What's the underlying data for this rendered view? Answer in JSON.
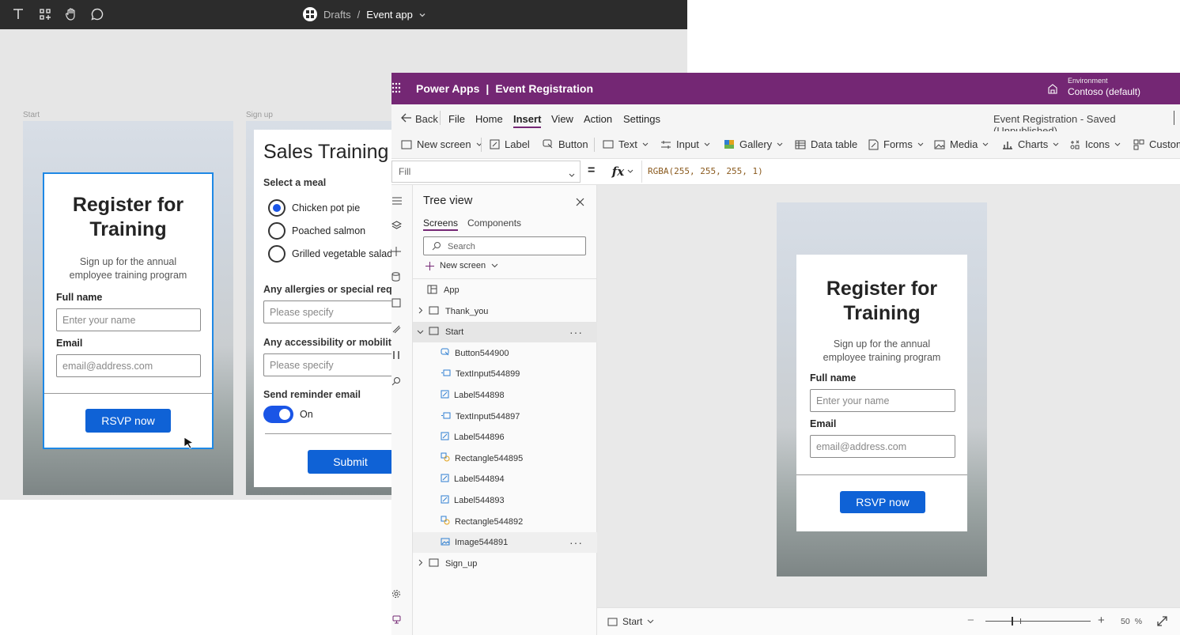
{
  "figma": {
    "breadcrumb": {
      "folder": "Drafts",
      "separator": "/",
      "file": "Event app"
    },
    "frames": {
      "start": {
        "label": "Start",
        "title": "Register for Training",
        "subtitle_l1": "Sign up for the annual",
        "subtitle_l2": "employee training program",
        "fullname_label": "Full name",
        "fullname_placeholder": "Enter your name",
        "email_label": "Email",
        "email_placeholder": "email@address.com",
        "button": "RSVP now"
      },
      "signup": {
        "label": "Sign up",
        "title": "Sales Training",
        "meal_label": "Select a meal",
        "meals": [
          "Chicken pot pie",
          "Poached salmon",
          "Grilled vegetable salad"
        ],
        "allergies_label": "Any allergies or special reque",
        "allergies_placeholder": "Please specify",
        "access_label": "Any accessibility or mobility",
        "access_placeholder": "Please specify",
        "reminder_label": "Send reminder email",
        "toggle_state": "On",
        "submit": "Submit"
      }
    }
  },
  "powerapps": {
    "app_name": "Power Apps",
    "separator": "|",
    "project": "Event Registration",
    "environment_label": "Environment",
    "environment_value": "Contoso (default)",
    "menu": {
      "back": "Back",
      "items": [
        "File",
        "Home",
        "Insert",
        "View",
        "Action",
        "Settings"
      ],
      "active": "Insert"
    },
    "save_status": "Event Registration - Saved (Unpublished)",
    "ribbon": [
      "New screen",
      "Label",
      "Button",
      "Text",
      "Input",
      "Gallery",
      "Data table",
      "Forms",
      "Media",
      "Charts",
      "Icons",
      "Custom"
    ],
    "formula": {
      "property": "Fill",
      "equals": "=",
      "fx": "fx",
      "value": "RGBA(255, 255, 255, 1)"
    },
    "tree": {
      "title": "Tree view",
      "tabs": [
        "Screens",
        "Components"
      ],
      "search_placeholder": "Search",
      "new_screen": "New screen",
      "app": "App",
      "screens": [
        "Thank_you",
        "Start",
        "Sign_up"
      ],
      "controls": [
        "Button544900",
        "TextInput544899",
        "Label544898",
        "TextInput544897",
        "Label544896",
        "Rectangle544895",
        "Label544894",
        "Label544893",
        "Rectangle544892",
        "Image544891"
      ],
      "more": "···"
    },
    "preview": {
      "title": "Register for Training",
      "subtitle_l1": "Sign up for the annual",
      "subtitle_l2": "employee training program",
      "fullname_label": "Full name",
      "fullname_placeholder": "Enter your name",
      "email_label": "Email",
      "email_placeholder": "email@address.com",
      "button": "RSVP now"
    },
    "status": {
      "screen": "Start",
      "zoom": "50",
      "zoom_unit": "%",
      "minus": "−",
      "plus": "+"
    }
  },
  "colors": {
    "purple": "#742774",
    "blue": "#0f62d6",
    "figma_bar": "#2c2c2c"
  }
}
